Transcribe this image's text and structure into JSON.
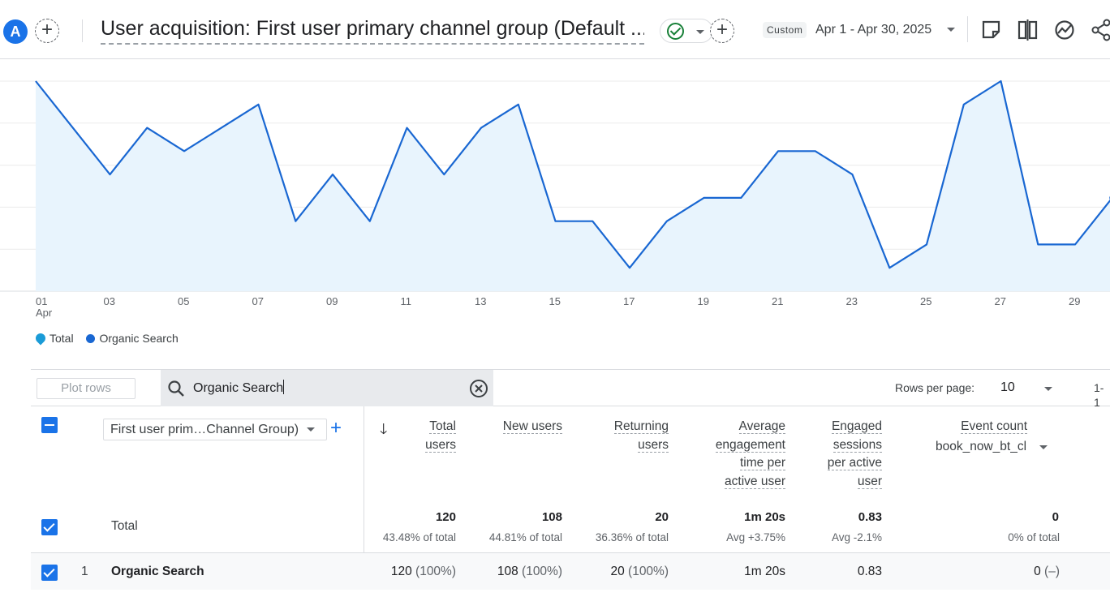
{
  "header": {
    "avatar_letter": "A",
    "title": "User acquisition: First user primary channel group (Default ...",
    "custom_label": "Custom",
    "date_range": "Apr 1 - Apr 30, 2025"
  },
  "chart_data": {
    "type": "line",
    "title": "",
    "x_tick_labels": [
      "01",
      "03",
      "05",
      "07",
      "09",
      "11",
      "13",
      "15",
      "17",
      "19",
      "21",
      "23",
      "25",
      "27",
      "29"
    ],
    "x_sublabel": "Apr",
    "x": [
      1,
      2,
      3,
      4,
      5,
      6,
      7,
      8,
      9,
      10,
      11,
      12,
      13,
      14,
      15,
      16,
      17,
      18,
      19,
      20,
      21,
      22,
      23,
      24,
      25,
      26,
      27,
      28,
      29,
      30
    ],
    "series": [
      {
        "name": "Organic Search",
        "values": [
          9,
          7,
          5,
          7,
          6,
          7,
          8,
          3,
          5,
          3,
          7,
          5,
          7,
          8,
          3,
          3,
          1,
          3,
          4,
          4,
          6,
          6,
          5,
          1,
          2,
          8,
          9,
          2,
          2,
          4
        ]
      }
    ],
    "ylim": [
      0,
      9
    ],
    "y_gridlines": 5,
    "legend": [
      "Total",
      "Organic Search"
    ],
    "legend_position": "bottom-left",
    "colors": {
      "line": "#1967d2",
      "fill": "#e8f4fd",
      "total_marker": "#1a9bd7"
    }
  },
  "toolbar": {
    "plot_rows_label": "Plot rows",
    "search_value": "Organic Search",
    "rows_per_page_label": "Rows per page:",
    "rows_per_page_value": "10",
    "pagination": "1-1"
  },
  "table": {
    "dimension_label": "First user prim…Channel Group)",
    "columns": [
      {
        "lines": [
          "Total",
          "users"
        ]
      },
      {
        "lines": [
          "New users"
        ]
      },
      {
        "lines": [
          "Returning",
          "users"
        ]
      },
      {
        "lines": [
          "Average",
          "engagement",
          "time per",
          "active user"
        ]
      },
      {
        "lines": [
          "Engaged",
          "sessions",
          "per active",
          "user"
        ]
      },
      {
        "lines": [
          "Event count"
        ]
      }
    ],
    "event_filter": "book_now_bt_cl",
    "total_label": "Total",
    "totals": [
      {
        "value": "120",
        "sub": "43.48% of total"
      },
      {
        "value": "108",
        "sub": "44.81% of total"
      },
      {
        "value": "20",
        "sub": "36.36% of total"
      },
      {
        "value": "1m 20s",
        "sub": "Avg +3.75%"
      },
      {
        "value": "0.83",
        "sub": "Avg -2.1%"
      },
      {
        "value": "0",
        "sub": "0% of total"
      }
    ],
    "rows": [
      {
        "index": "1",
        "name": "Organic Search",
        "cells": [
          {
            "value": "120",
            "pct": "(100%)"
          },
          {
            "value": "108",
            "pct": "(100%)"
          },
          {
            "value": "20",
            "pct": "(100%)"
          },
          {
            "value": "1m 20s",
            "pct": ""
          },
          {
            "value": "0.83",
            "pct": ""
          },
          {
            "value": "0",
            "pct": "(–)"
          }
        ]
      }
    ]
  }
}
